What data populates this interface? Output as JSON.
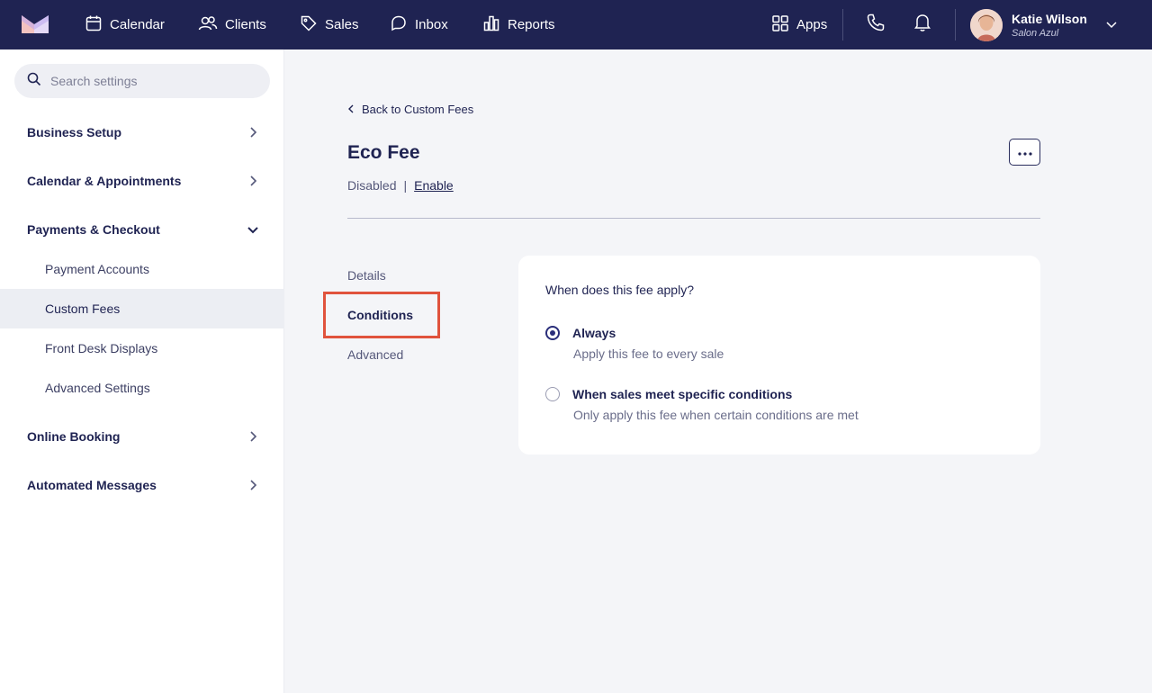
{
  "nav": {
    "calendar": "Calendar",
    "clients": "Clients",
    "sales": "Sales",
    "inbox": "Inbox",
    "reports": "Reports",
    "apps": "Apps"
  },
  "user": {
    "name": "Katie Wilson",
    "org": "Salon Azul"
  },
  "sidebar": {
    "search_placeholder": "Search settings",
    "sections": [
      {
        "label": "Business Setup",
        "expanded": false
      },
      {
        "label": "Calendar & Appointments",
        "expanded": false
      },
      {
        "label": "Payments & Checkout",
        "expanded": true,
        "items": [
          {
            "label": "Payment Accounts",
            "active": false
          },
          {
            "label": "Custom Fees",
            "active": true
          },
          {
            "label": "Front Desk Displays",
            "active": false
          },
          {
            "label": "Advanced Settings",
            "active": false
          }
        ]
      },
      {
        "label": "Online Booking",
        "expanded": false
      },
      {
        "label": "Automated Messages",
        "expanded": false
      }
    ]
  },
  "main": {
    "back_label": "Back to Custom Fees",
    "title": "Eco Fee",
    "status": "Disabled",
    "status_separator": "|",
    "enable_label": "Enable",
    "tabs": [
      {
        "label": "Details",
        "active": false
      },
      {
        "label": "Conditions",
        "active": true
      },
      {
        "label": "Advanced",
        "active": false
      }
    ],
    "card": {
      "question": "When does this fee apply?",
      "options": [
        {
          "title": "Always",
          "description": "Apply this fee to every sale",
          "selected": true
        },
        {
          "title": "When sales meet specific conditions",
          "description": "Only apply this fee when certain conditions are met",
          "selected": false
        }
      ]
    }
  },
  "colors": {
    "topbar": "#1f2352",
    "accent": "#2a2e7a",
    "highlight": "#e0533d",
    "logo_left": "#f3c3c0",
    "logo_right": "#e4d9f7"
  },
  "icons": {
    "logo": "brand-logo-icon",
    "calendar": "calendar-icon",
    "clients": "clients-icon",
    "sales": "tag-icon",
    "inbox": "chat-icon",
    "reports": "bar-chart-icon",
    "apps": "grid-icon",
    "phone": "phone-icon",
    "bell": "bell-icon",
    "chevron_down": "chevron-down-icon",
    "chevron_right": "chevron-right-icon",
    "chevron_left": "chevron-left-icon",
    "search": "search-icon",
    "more": "more-horizontal-icon"
  }
}
